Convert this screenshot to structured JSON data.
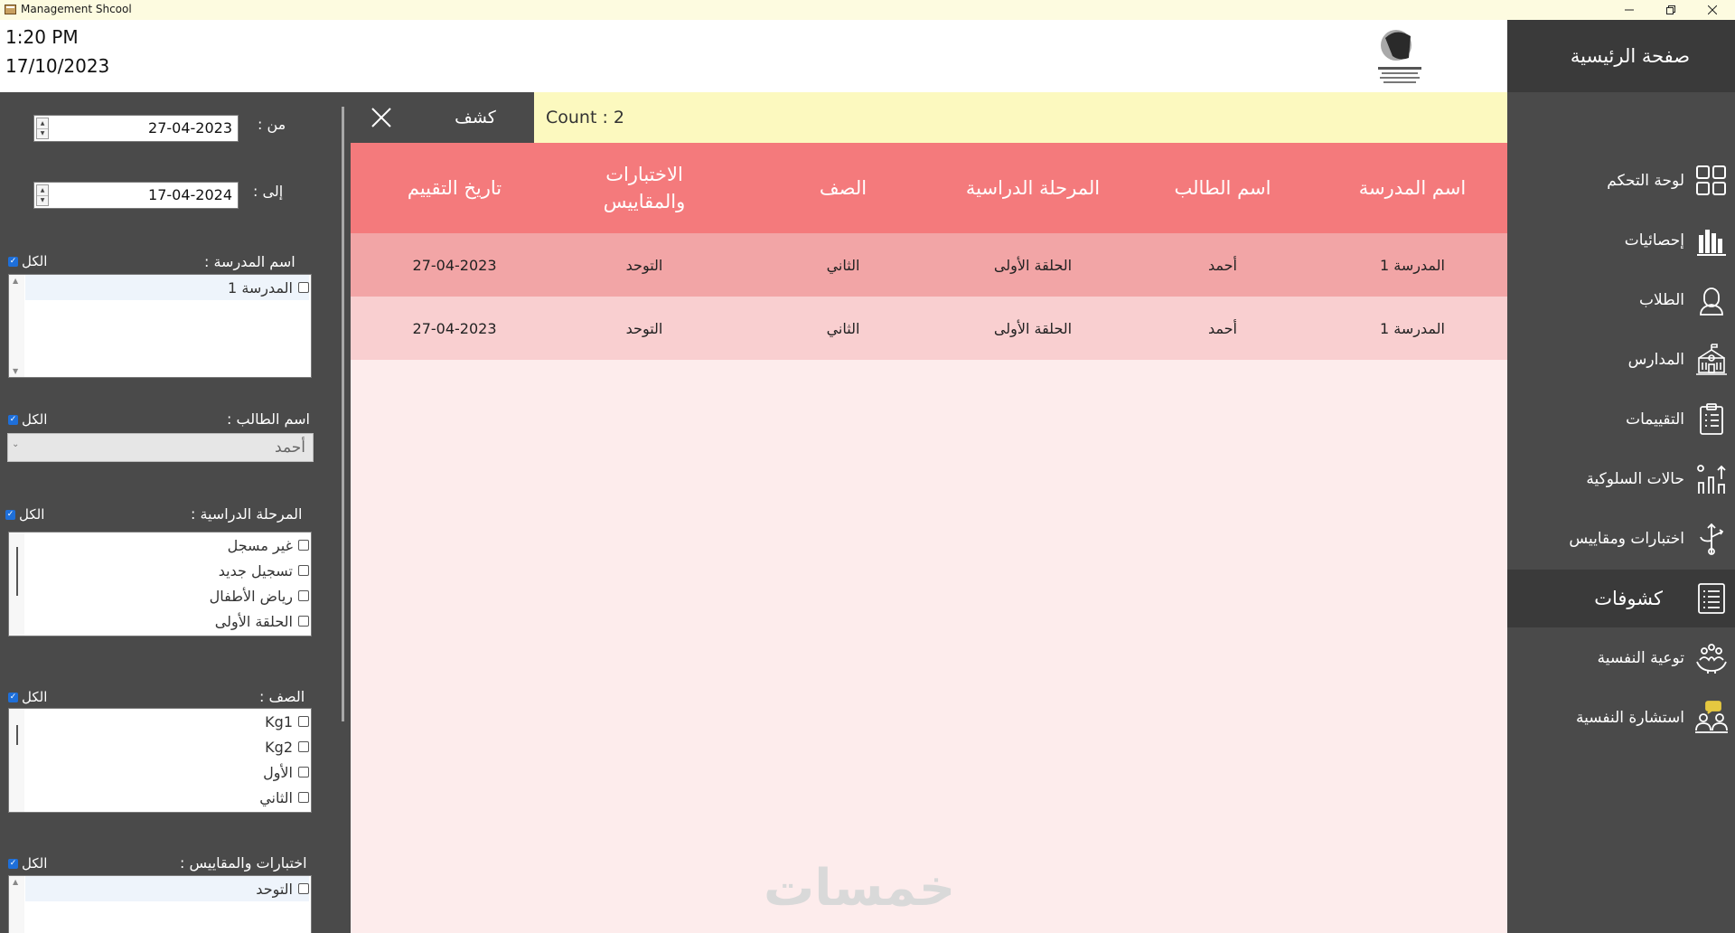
{
  "window": {
    "title": "Management Shcool"
  },
  "header": {
    "time": "1:20 PM",
    "date": "17/10/2023"
  },
  "nav": {
    "home": "صفحة الرئيسية",
    "items": [
      {
        "label": "لوحة التحكم",
        "icon": "dashboard-icon"
      },
      {
        "label": "إحصائيات",
        "icon": "bar-chart-icon"
      },
      {
        "label": "الطلاب",
        "icon": "student-icon"
      },
      {
        "label": "المدارس",
        "icon": "school-building-icon"
      },
      {
        "label": "التقييمات",
        "icon": "clipboard-icon"
      },
      {
        "label": "حالات السلوكية",
        "icon": "behavior-icon"
      },
      {
        "label": "اختبارات ومقاييس",
        "icon": "tests-icon"
      },
      {
        "label": "كشوفات",
        "icon": "report-list-icon",
        "active": true
      },
      {
        "label": "توعية النفسية",
        "icon": "awareness-icon"
      },
      {
        "label": "استشارة النفسية",
        "icon": "consultation-icon"
      }
    ]
  },
  "filters": {
    "from_label": "من :",
    "from_value": "27-04-2023",
    "to_label": "إلى :",
    "to_value": "17-04-2024",
    "all_label": "الكل",
    "school_label": "اسم المدرسة :",
    "schools": [
      "المدرسة 1"
    ],
    "student_label": "اسم الطالب :",
    "student_value": "أحمد",
    "stage_label": "المرحلة الدراسية :",
    "stages": [
      "غير مسجل",
      "تسجيل جديد",
      "رياض الأطفال",
      "الحلقة الأولى"
    ],
    "grade_label": "الصف :",
    "grades": [
      "Kg1",
      "Kg2",
      "الأول",
      "الثاني"
    ],
    "tests_label": "اختبارات والمقاييس :",
    "tests": [
      "التوحد"
    ]
  },
  "toolbar": {
    "reveal_label": "كشف",
    "count_text": "Count : 2"
  },
  "table": {
    "headers": [
      "اسم المدرسة",
      "اسم الطالب",
      "المرحلة الدراسية",
      "الصف",
      "الاختبارات والمقاييس",
      "تاريخ التقييم"
    ],
    "rows": [
      [
        "المدرسة 1",
        "أحمد",
        "الحلقة الأولى",
        "الثاني",
        "التوحد",
        "27-04-2023"
      ],
      [
        "المدرسة 1",
        "أحمد",
        "الحلقة الأولى",
        "الثاني",
        "التوحد",
        "27-04-2023"
      ]
    ]
  },
  "watermark": "خمسات",
  "colors": {
    "nav_bg": "#4a4a4a",
    "toolbar_bg": "#fcf9bf",
    "header_bg": "#f47a7c",
    "row_dark": "#f2a5a6",
    "row_light": "#f9cfd0",
    "panel_bg": "#fdecec"
  }
}
